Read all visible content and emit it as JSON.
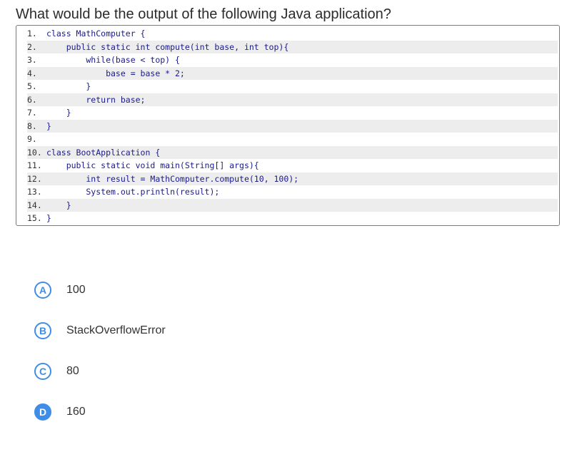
{
  "question": "What would be the output of the following Java application?",
  "code": [
    {
      "num": "1.",
      "text": "class MathComputer {"
    },
    {
      "num": "2.",
      "text": "    public static int compute(int base, int top){"
    },
    {
      "num": "3.",
      "text": "        while(base < top) {"
    },
    {
      "num": "4.",
      "text": "            base = base * 2;"
    },
    {
      "num": "5.",
      "text": "        }"
    },
    {
      "num": "6.",
      "text": "        return base;"
    },
    {
      "num": "7.",
      "text": "    }"
    },
    {
      "num": "8.",
      "text": "}"
    },
    {
      "num": "9.",
      "text": ""
    },
    {
      "num": "10.",
      "text": "class BootApplication {"
    },
    {
      "num": "11.",
      "text": "    public static void main(String[] args){"
    },
    {
      "num": "12.",
      "text": "        int result = MathComputer.compute(10, 100);"
    },
    {
      "num": "13.",
      "text": "        System.out.println(result);"
    },
    {
      "num": "14.",
      "text": "    }"
    },
    {
      "num": "15.",
      "text": "}"
    }
  ],
  "options": [
    {
      "letter": "A",
      "text": "100",
      "selected": false
    },
    {
      "letter": "B",
      "text": "StackOverflowError",
      "selected": false
    },
    {
      "letter": "C",
      "text": "80",
      "selected": false
    },
    {
      "letter": "D",
      "text": "160",
      "selected": true
    }
  ],
  "colors": {
    "accent": "#3f8de6",
    "code_keyword": "#1a1a8c",
    "stripe": "#ededed"
  }
}
